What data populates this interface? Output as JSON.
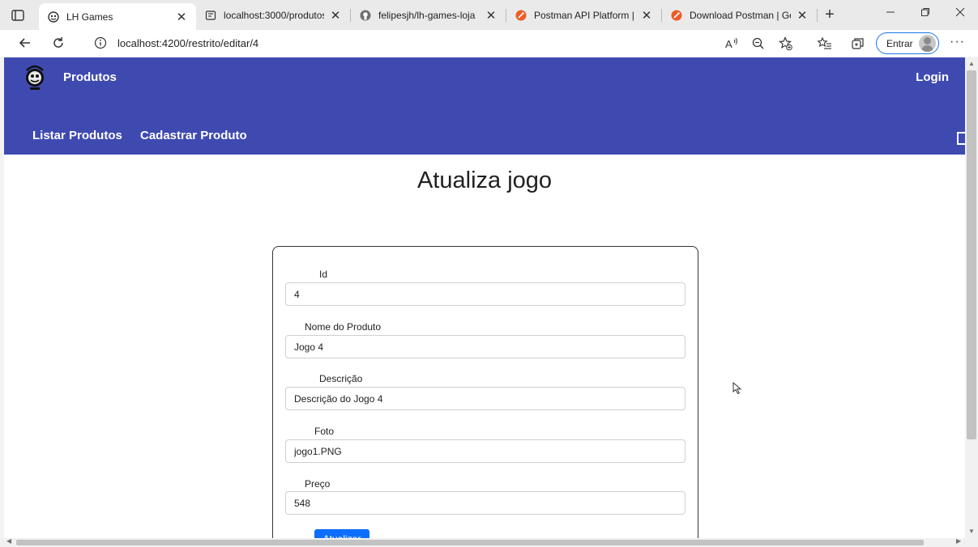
{
  "browser": {
    "tabs": [
      {
        "title": "LH Games",
        "favicon": "game-controller-icon",
        "active": true
      },
      {
        "title": "localhost:3000/produtos",
        "favicon": "local-page-icon",
        "active": false
      },
      {
        "title": "felipesjh/lh-games-loja",
        "favicon": "github-icon",
        "active": false
      },
      {
        "title": "Postman API Platform | Sig",
        "favicon": "postman-icon",
        "active": false
      },
      {
        "title": "Download Postman | Get S",
        "favicon": "postman-icon",
        "active": false
      }
    ],
    "url": "localhost:4200/restrito/editar/4",
    "signin_label": "Entrar"
  },
  "colors": {
    "nav_background": "#3f4ab1",
    "button_primary": "#0d6efd",
    "postman_orange": "#ef5b25"
  },
  "nav": {
    "brand": "Produtos",
    "login": "Login",
    "menu": [
      "Listar Produtos",
      "Cadastrar Produto"
    ]
  },
  "page": {
    "heading": "Atualiza jogo"
  },
  "form": {
    "fields": [
      {
        "label": "Id",
        "value": "4"
      },
      {
        "label": "Nome do Produto",
        "value": "Jogo 4"
      },
      {
        "label": "Descrição",
        "value": "Descrição do Jogo 4"
      },
      {
        "label": "Foto",
        "value": "jogo1.PNG"
      },
      {
        "label": "Preço",
        "value": "548"
      }
    ],
    "submit_label": "Atualizar"
  }
}
